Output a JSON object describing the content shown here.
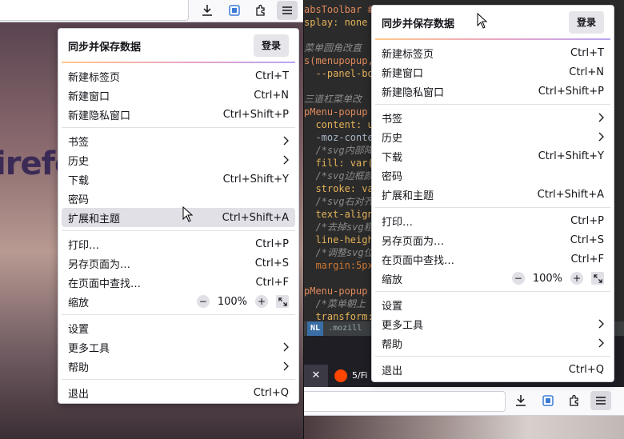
{
  "left": {
    "background_brand": "irefo",
    "menu": {
      "header_title": "同步并保存数据",
      "login_label": "登录",
      "groups": [
        [
          {
            "label": "新建标签页",
            "shortcut": "Ctrl+T"
          },
          {
            "label": "新建窗口",
            "shortcut": "Ctrl+N"
          },
          {
            "label": "新建隐私窗口",
            "shortcut": "Ctrl+Shift+P"
          }
        ],
        [
          {
            "label": "书签",
            "submenu": true
          },
          {
            "label": "历史",
            "submenu": true
          },
          {
            "label": "下载",
            "shortcut": "Ctrl+Shift+Y"
          },
          {
            "label": "密码"
          },
          {
            "label": "扩展和主题",
            "shortcut": "Ctrl+Shift+A",
            "hover": true
          }
        ],
        [
          {
            "label": "打印…",
            "shortcut": "Ctrl+P"
          },
          {
            "label": "另存页面为…",
            "shortcut": "Ctrl+S"
          },
          {
            "label": "在页面中查找…",
            "shortcut": "Ctrl+F"
          }
        ]
      ],
      "zoom": {
        "label": "缩放",
        "minus": "−",
        "value": "100%",
        "plus": "+"
      },
      "groups2": [
        {
          "label": "设置"
        },
        {
          "label": "更多工具",
          "submenu": true
        },
        {
          "label": "帮助",
          "submenu": true
        }
      ],
      "quit": {
        "label": "退出",
        "shortcut": "Ctrl+Q"
      }
    }
  },
  "right": {
    "code_lines": [
      "absToolbar #",
      "splay: none",
      "",
      "菜单圆角改直",
      "s(menupopup,",
      "  --panel-bo",
      "",
      "三道杠菜单改",
      "pMenu-popup",
      "  content: u",
      "  -moz-conte",
      "  /*svg内部降",
      "  fill: var(",
      "  /*svg边框颜",
      "  stroke: va",
      "  /*svg右对齐",
      "  text-align",
      "  /*去掉svg粗",
      "  line-heigh",
      "  /*调整svg位",
      "  margin:5px",
      "",
      "pMenu-popup",
      "  /*菜单朝上",
      "  transform:"
    ],
    "status_mode": "NL",
    "status_text": ".mozill",
    "tab_close": "✕",
    "tab_label": "5/Fi",
    "menu": {
      "header_title": "同步并保存数据",
      "login_label": "登录",
      "groups": [
        [
          {
            "label": "新建标签页",
            "shortcut": "Ctrl+T"
          },
          {
            "label": "新建窗口",
            "shortcut": "Ctrl+N"
          },
          {
            "label": "新建隐私窗口",
            "shortcut": "Ctrl+Shift+P"
          }
        ],
        [
          {
            "label": "书签",
            "submenu": true
          },
          {
            "label": "历史",
            "submenu": true
          },
          {
            "label": "下载",
            "shortcut": "Ctrl+Shift+Y"
          },
          {
            "label": "密码"
          },
          {
            "label": "扩展和主题",
            "shortcut": "Ctrl+Shift+A"
          }
        ],
        [
          {
            "label": "打印…",
            "shortcut": "Ctrl+P"
          },
          {
            "label": "另存页面为…",
            "shortcut": "Ctrl+S"
          },
          {
            "label": "在页面中查找…",
            "shortcut": "Ctrl+F"
          }
        ]
      ],
      "zoom": {
        "label": "缩放",
        "minus": "−",
        "value": "100%",
        "plus": "+"
      },
      "groups2": [
        {
          "label": "设置"
        },
        {
          "label": "更多工具",
          "submenu": true
        },
        {
          "label": "帮助",
          "submenu": true
        }
      ],
      "quit": {
        "label": "退出",
        "shortcut": "Ctrl+Q"
      }
    }
  },
  "toolbar_icons": [
    "download-icon",
    "container-icon",
    "extensions-icon",
    "hamburger-menu-icon"
  ]
}
